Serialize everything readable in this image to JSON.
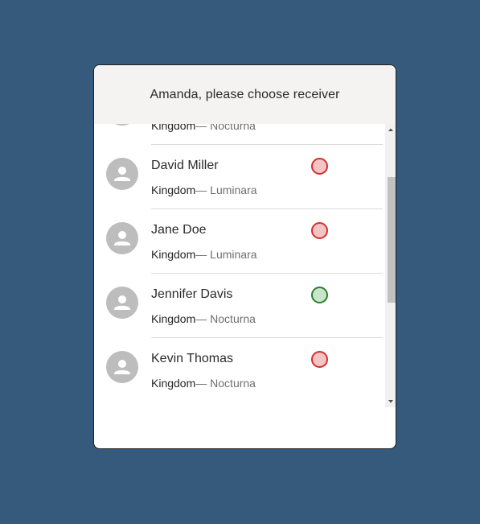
{
  "dialog": {
    "title": "Amanda, please choose receiver"
  },
  "receivers": [
    {
      "name": "",
      "kingdom_label": "Kingdom",
      "kingdom": "Nocturna",
      "status": "offline"
    },
    {
      "name": "David Miller",
      "kingdom_label": "Kingdom",
      "kingdom": "Luminara",
      "status": "offline"
    },
    {
      "name": "Jane Doe",
      "kingdom_label": "Kingdom",
      "kingdom": "Luminara",
      "status": "offline"
    },
    {
      "name": "Jennifer Davis",
      "kingdom_label": "Kingdom",
      "kingdom": "Nocturna",
      "status": "online"
    },
    {
      "name": "Kevin Thomas",
      "kingdom_label": "Kingdom",
      "kingdom": "Nocturna",
      "status": "offline"
    }
  ],
  "separator": "— ",
  "icons": {
    "avatar": "person-icon",
    "status": "status-dot-icon",
    "scroll_up": "arrow-up-icon",
    "scroll_down": "arrow-down-icon"
  },
  "colors": {
    "background": "#355a7c",
    "header": "#f5f3f1",
    "offline_border": "#d32f2f",
    "offline_fill": "#f4c4c4",
    "online_border": "#2e7d32",
    "online_fill": "#c8e6c9"
  }
}
